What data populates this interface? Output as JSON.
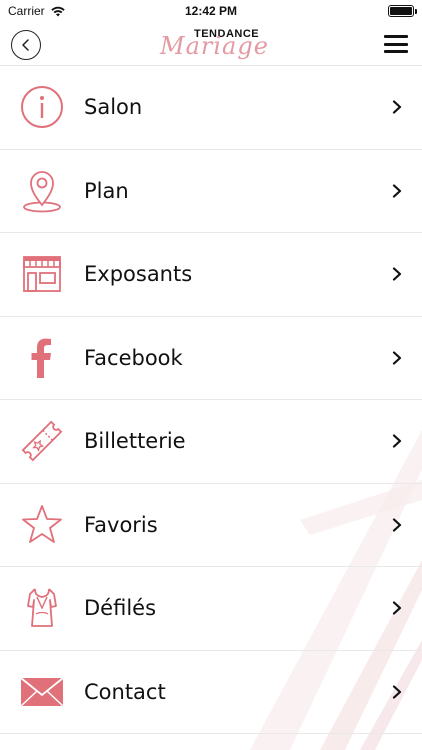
{
  "status_bar": {
    "carrier": "Carrier",
    "time": "12:42 PM"
  },
  "header": {
    "logo_top": "TENDANCE",
    "logo_script": "Mariage",
    "back_icon": "chevron-left-circle-icon",
    "menu_icon": "hamburger-menu-icon"
  },
  "colors": {
    "accent": "#e0707a",
    "logo_pink": "#e39aa2",
    "divider": "#e8e8e8"
  },
  "menu": {
    "items": [
      {
        "label": "Salon",
        "icon": "info-icon"
      },
      {
        "label": "Plan",
        "icon": "map-pin-icon"
      },
      {
        "label": "Exposants",
        "icon": "storefront-icon"
      },
      {
        "label": "Facebook",
        "icon": "facebook-icon"
      },
      {
        "label": "Billetterie",
        "icon": "ticket-icon"
      },
      {
        "label": "Favoris",
        "icon": "star-icon"
      },
      {
        "label": "Défilés",
        "icon": "dress-icon"
      },
      {
        "label": "Contact",
        "icon": "envelope-icon"
      }
    ]
  }
}
